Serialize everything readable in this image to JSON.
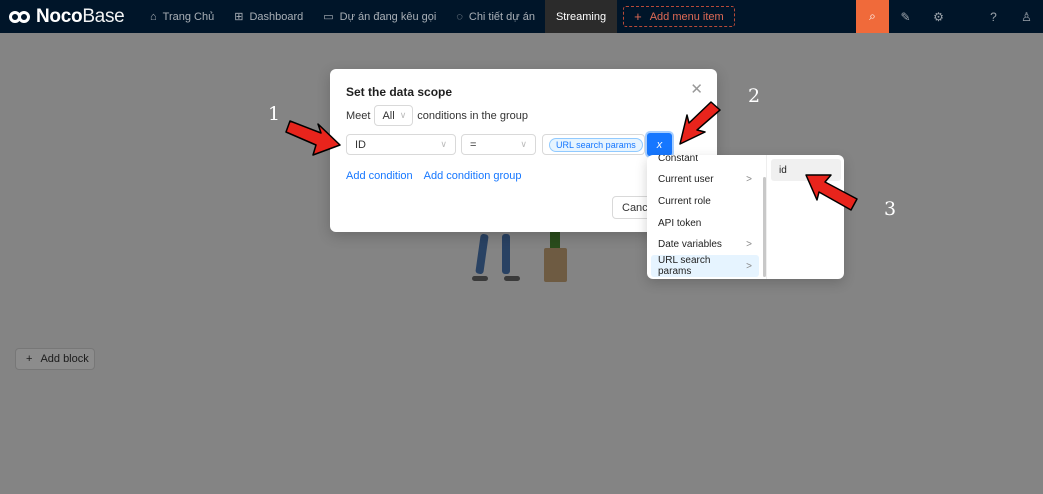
{
  "nav": {
    "logo_bold": "Noco",
    "logo_thin": "Base",
    "items": [
      {
        "icon": "bank-icon",
        "glyph": "🏛",
        "label": "Trang Chủ"
      },
      {
        "icon": "dashboard-icon",
        "glyph": "⊞",
        "label": "Dashboard"
      },
      {
        "icon": "message-icon",
        "glyph": "▭",
        "label": "Dự án đang kêu gọi"
      },
      {
        "icon": "shield-icon",
        "glyph": "◌",
        "label": "Chi tiết dự án"
      },
      {
        "icon": "",
        "glyph": "",
        "label": "Streaming"
      }
    ],
    "add_menu_label": "Add menu item",
    "tools": [
      "highlighter-icon",
      "plugin-icon",
      "settings-icon",
      "help-icon",
      "user-icon"
    ]
  },
  "page": {
    "add_block_label": "Add block"
  },
  "modal": {
    "title": "Set the data scope",
    "meet_prefix": "Meet",
    "meet_value": "All",
    "meet_suffix": "conditions in the group",
    "field_value": "ID",
    "operator_value": "=",
    "value_tag": "URL search params",
    "var_button": "x",
    "add_condition": "Add condition",
    "add_condition_group": "Add condition group",
    "cancel_label": "Cance"
  },
  "cascader": {
    "column1": [
      {
        "label": "Constant",
        "has_children": false
      },
      {
        "label": "Current user",
        "has_children": true
      },
      {
        "label": "Current role",
        "has_children": false
      },
      {
        "label": "API token",
        "has_children": false
      },
      {
        "label": "Date variables",
        "has_children": true
      },
      {
        "label": "URL search params",
        "has_children": true,
        "selected": true
      }
    ],
    "column2": [
      {
        "label": "id",
        "selected": true
      }
    ]
  },
  "annotations": [
    "1",
    "2",
    "3"
  ]
}
